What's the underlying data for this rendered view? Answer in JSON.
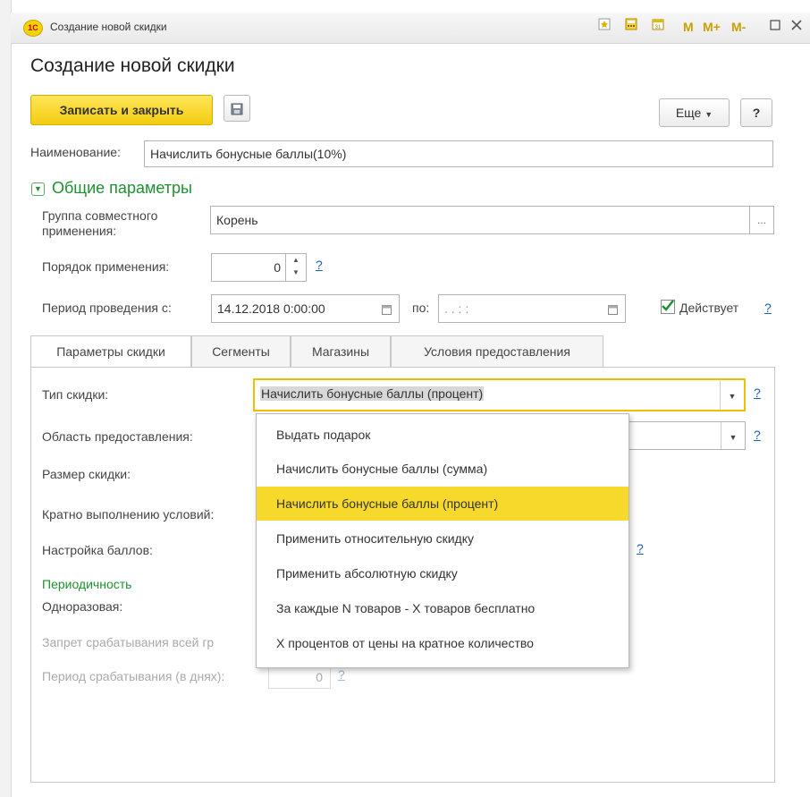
{
  "window": {
    "title": "Создание новой скидки",
    "logo": "1С"
  },
  "toolbar_icons": {
    "m": "M",
    "mplus": "M+",
    "mminus": "M-"
  },
  "form": {
    "title": "Создание новой скидки",
    "save_close": "Записать и закрыть",
    "more": "Еще",
    "help": "?"
  },
  "name_label": "Наименование:",
  "name_value": "Начислить бонусные баллы(10%)",
  "general_section": "Общие параметры",
  "group_label_1": "Группа совместного",
  "group_label_2": "применения:",
  "group_value": "Корень",
  "group_btn": "...",
  "order_label": "Порядок применения:",
  "order_value": "0",
  "help_q": "?",
  "period_label": "Период проведения с:",
  "period_from": "14.12.2018  0:00:00",
  "period_to_label": "по:",
  "period_to": " .  .        :  :",
  "active_label": "Действует",
  "tabs": [
    {
      "label": "Параметры скидки"
    },
    {
      "label": "Сегменты"
    },
    {
      "label": "Магазины"
    },
    {
      "label": "Условия предоставления"
    }
  ],
  "params": {
    "type_label": "Тип скидки:",
    "type_value": "Начислить бонусные баллы (процент)",
    "area_label": "Область предоставления:",
    "size_label": "Размер скидки:",
    "multiple_label": "Кратно выполнению условий:",
    "points_label": "Настройка баллов:",
    "periodicity": "Периодичность",
    "one_time": "Одноразовая:",
    "ban_label": "Запрет срабатывания всей гр",
    "period_days_label": "Период срабатывания (в днях):",
    "period_days_value": "0"
  },
  "dropdown_items": [
    "Выдать подарок",
    "Начислить бонусные баллы (сумма)",
    "Начислить бонусные баллы (процент)",
    "Применить относительную скидку",
    "Применить абсолютную скидку",
    "За каждые N товаров - X товаров бесплатно",
    "X процентов от цены на кратное количество"
  ],
  "dropdown_selected_index": 2,
  "colors": {
    "accent": "#f6d92a",
    "section_green": "#1e9130",
    "link": "#1a5fb4"
  }
}
